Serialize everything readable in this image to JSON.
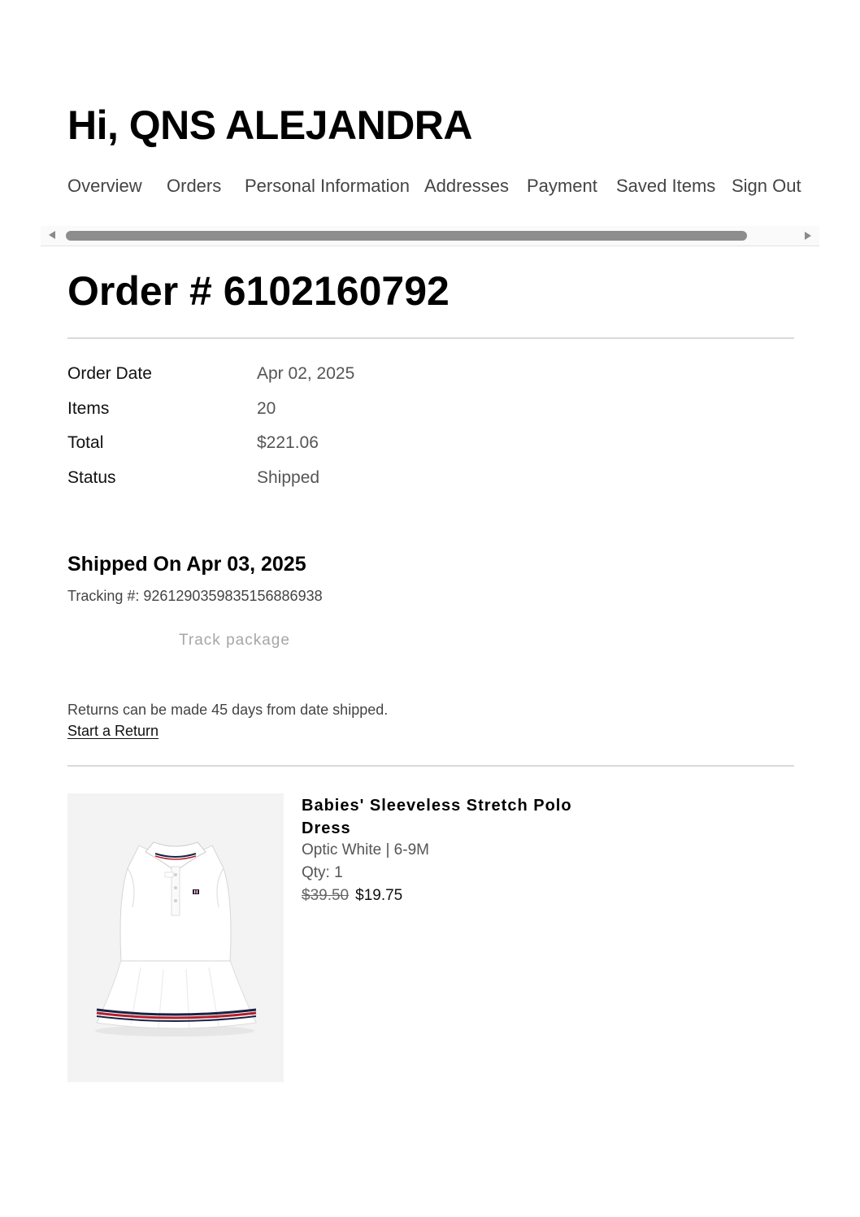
{
  "header": {
    "greeting": "Hi, QNS ALEJANDRA"
  },
  "nav": {
    "items": [
      {
        "label": "Overview"
      },
      {
        "label": "Orders"
      },
      {
        "label": "Personal Information"
      },
      {
        "label": "Addresses"
      },
      {
        "label": "Payment"
      },
      {
        "label": "Saved Items"
      },
      {
        "label": "Sign Out"
      }
    ]
  },
  "order": {
    "title": "Order # 6102160792",
    "summary": [
      {
        "label": "Order Date",
        "value": "Apr 02, 2025"
      },
      {
        "label": "Items",
        "value": "20"
      },
      {
        "label": "Total",
        "value": "$221.06"
      },
      {
        "label": "Status",
        "value": "Shipped"
      }
    ]
  },
  "shipment": {
    "heading": "Shipped On Apr 03, 2025",
    "tracking": "Tracking #: 926129035983515688693​8",
    "track_button": "Track package",
    "returns_note": "Returns can be made 45 days from date shipped.",
    "return_link": "Start a Return"
  },
  "product": {
    "name": "Babies' Sleeveless Stretch Polo Dress",
    "variant": "Optic White | 6-9M",
    "qty": "Qty: 1",
    "original_price": "$39.50",
    "sale_price": "$19.75"
  }
}
